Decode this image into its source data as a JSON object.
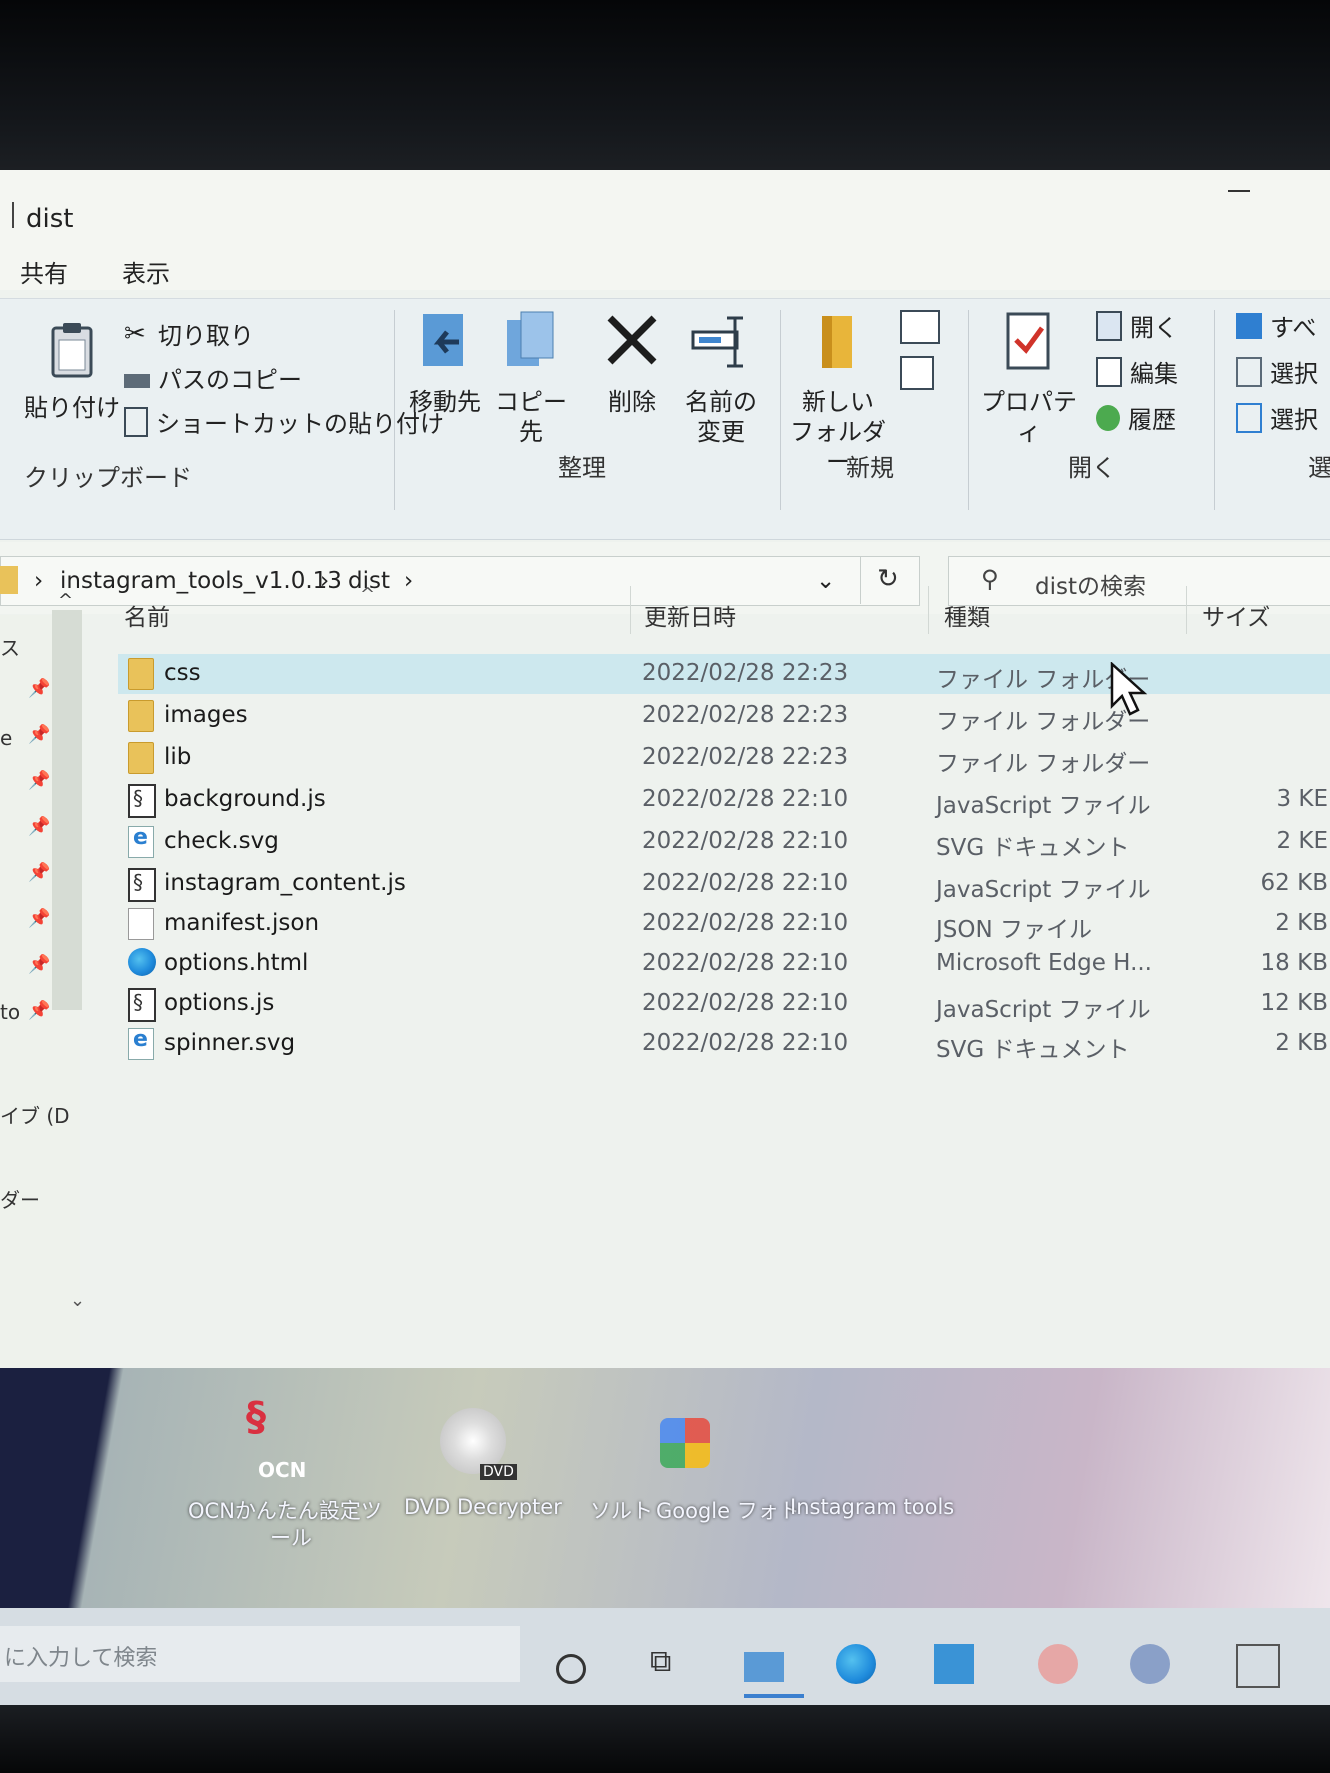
{
  "window": {
    "title": "dist"
  },
  "menu": {
    "tabs": [
      "共有",
      "表示"
    ]
  },
  "ribbon": {
    "clipboard": {
      "paste_label": "貼り付け",
      "cut_label": "切り取り",
      "copy_path_label": "パスのコピー",
      "paste_shortcut_label": "ショートカットの貼り付け",
      "group_label": "クリップボード"
    },
    "organize": {
      "move_to_line1": "移動先",
      "copy_to_line1": "コピー先",
      "delete_label": "削除",
      "rename_line1": "名前の",
      "rename_line2": "変更",
      "group_label": "整理"
    },
    "new": {
      "new_folder_line1": "新しい",
      "new_folder_line2": "フォルダー",
      "group_label": "新規"
    },
    "open": {
      "properties_label": "プロパティ",
      "open_label": "開く",
      "edit_label": "編集",
      "history_label": "履歴",
      "group_label": "開く"
    },
    "select": {
      "select_all_label": "すべ",
      "select_none_label": "選択",
      "invert_label": "選択",
      "group_label": "選"
    }
  },
  "address": {
    "breadcrumbs": [
      "instagram_tools_v1.0.13",
      "dist"
    ],
    "search_placeholder": "distの検索"
  },
  "nav": {
    "partial_labels": [
      "ス",
      "e",
      "to",
      "イブ (D",
      "ダー"
    ]
  },
  "columns": {
    "name": "名前",
    "date": "更新日時",
    "type": "種類",
    "size": "サイズ"
  },
  "files": [
    {
      "name": "css",
      "date": "2022/02/28 22:23",
      "type": "ファイル フォルダー",
      "size": "",
      "icon": "folder-icon"
    },
    {
      "name": "images",
      "date": "2022/02/28 22:23",
      "type": "ファイル フォルダー",
      "size": "",
      "icon": "folder-icon"
    },
    {
      "name": "lib",
      "date": "2022/02/28 22:23",
      "type": "ファイル フォルダー",
      "size": "",
      "icon": "folder-icon"
    },
    {
      "name": "background.js",
      "date": "2022/02/28 22:10",
      "type": "JavaScript ファイル",
      "size": "3 KE",
      "icon": "js-file-icon"
    },
    {
      "name": "check.svg",
      "date": "2022/02/28 22:10",
      "type": "SVG ドキュメント",
      "size": "2 KE",
      "icon": "svg-file-icon"
    },
    {
      "name": "instagram_content.js",
      "date": "2022/02/28 22:10",
      "type": "JavaScript ファイル",
      "size": "62 KB",
      "icon": "js-file-icon"
    },
    {
      "name": "manifest.json",
      "date": "2022/02/28 22:10",
      "type": "JSON ファイル",
      "size": "2 KB",
      "icon": "json-file-icon"
    },
    {
      "name": "options.html",
      "date": "2022/02/28 22:10",
      "type": "Microsoft Edge H...",
      "size": "18 KB",
      "icon": "edge-icon"
    },
    {
      "name": "options.js",
      "date": "2022/02/28 22:10",
      "type": "JavaScript ファイル",
      "size": "12 KB",
      "icon": "js-file-icon"
    },
    {
      "name": "spinner.svg",
      "date": "2022/02/28 22:10",
      "type": "SVG ドキュメント",
      "size": "2 KB",
      "icon": "svg-file-icon"
    }
  ],
  "desktop": {
    "icons": [
      {
        "label_line1": "OCNかんたん設定ツ",
        "label_line2": "ール",
        "logo_text": "OCN"
      },
      {
        "label_line1": "DVD Decrypter",
        "badge": "DVD"
      },
      {
        "label_line1": "ソルト"
      },
      {
        "label_line1": "Google フォト"
      },
      {
        "label_line1": "Instagram tools"
      }
    ]
  },
  "taskbar": {
    "search_placeholder": "に入力して検索"
  },
  "colors": {
    "selected_row": "#cde8ee",
    "folder": "#e9c25a",
    "accent_blue": "#2f7fd1",
    "delete_x": "#1d1d1d"
  }
}
